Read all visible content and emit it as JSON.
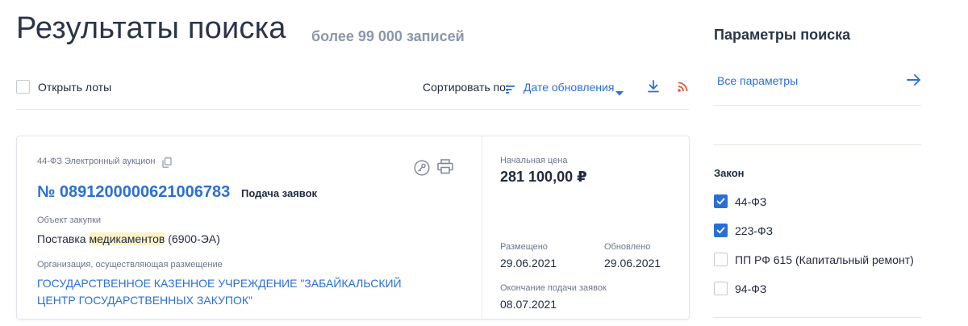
{
  "header": {
    "title": "Результаты поиска",
    "count": "более 99 000 записей"
  },
  "toolbar": {
    "open_lots_label": "Открыть лоты",
    "open_lots_checked": false,
    "sort_label": "Сортировать по:",
    "sort_value": "Дате обновления",
    "icons": [
      "sort-lines-icon",
      "chevron-down-icon",
      "download-icon",
      "rss-icon"
    ]
  },
  "result": {
    "law_type": "44-ФЗ Электронный аукцион",
    "number": "№ 0891200000621006783",
    "status": "Подача заявок",
    "object_label": "Объект закупки",
    "object_prefix": "Поставка ",
    "object_highlight": "медикаментов",
    "object_suffix": " (6900-ЭА)",
    "org_label": "Организация, осуществляющая размещение",
    "org_value": "ГОСУДАРСТВЕННОЕ КАЗЕННОЕ УЧРЕЖДЕНИЕ \"ЗАБАЙКАЛЬСКИЙ ЦЕНТР ГОСУДАРСТВЕННЫХ ЗАКУПОК\"",
    "price_label": "Начальная цена",
    "price_value": "281 100,00 ₽",
    "placed_label": "Размещено",
    "placed_value": "29.06.2021",
    "updated_label": "Обновлено",
    "updated_value": "29.06.2021",
    "deadline_label": "Окончание подачи заявок",
    "deadline_value": "08.07.2021",
    "icons": [
      "copy-icon",
      "key-icon",
      "print-icon"
    ]
  },
  "sidebar": {
    "title": "Параметры поиска",
    "all_params": "Все параметры",
    "law_title": "Закон",
    "laws": [
      {
        "label": "44-ФЗ",
        "checked": true
      },
      {
        "label": "223-ФЗ",
        "checked": true
      },
      {
        "label": "ПП РФ 615 (Капитальный ремонт)",
        "checked": false
      },
      {
        "label": "94-ФЗ",
        "checked": false
      }
    ]
  },
  "colors": {
    "accent": "#2b6fd6",
    "text": "#1f2a3d",
    "muted": "#6b778a",
    "highlight": "#fdf1c7",
    "rss": "#e8573a"
  }
}
